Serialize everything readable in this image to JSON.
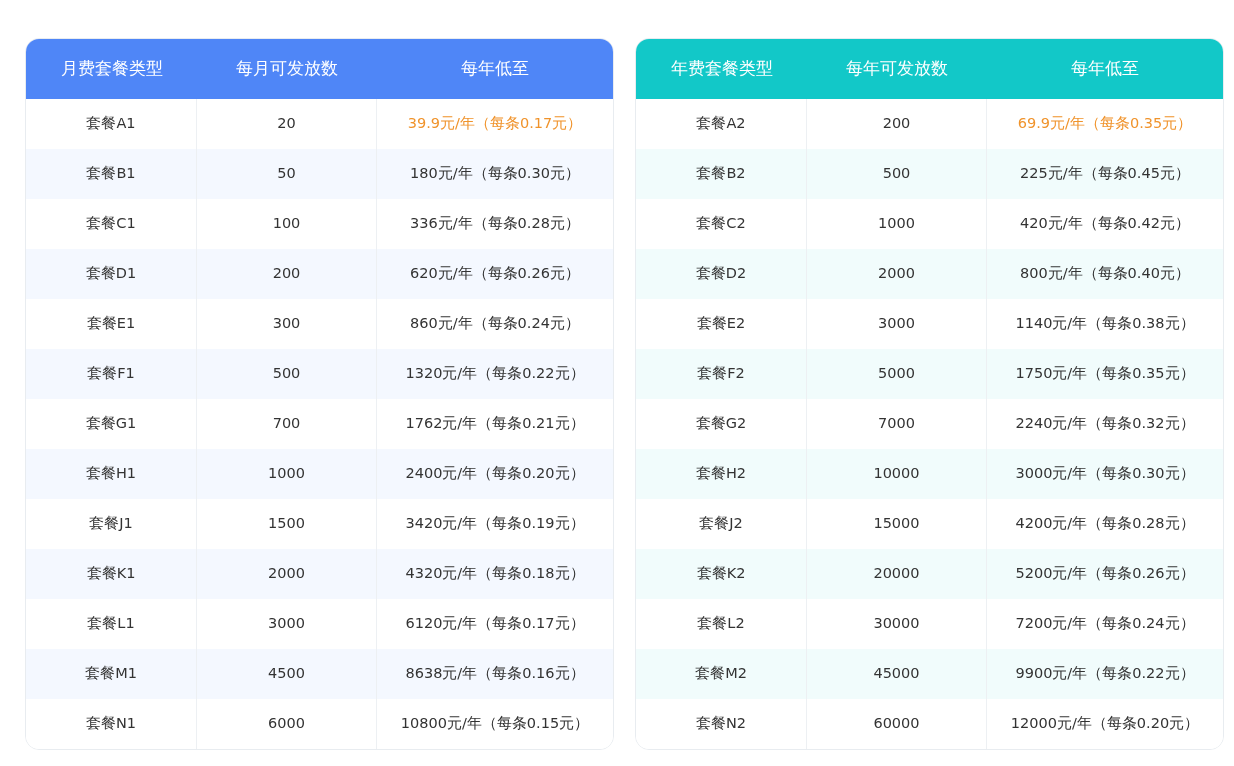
{
  "tables": [
    {
      "color": "#4f86f7",
      "columns": [
        "月费套餐类型",
        "每月可发放数",
        "每年低至"
      ],
      "rows": [
        {
          "cells": [
            "套餐A1",
            "20",
            "39.9元/年（每条0.17元）"
          ],
          "highlighted": true
        },
        {
          "cells": [
            "套餐B1",
            "50",
            "180元/年（每条0.30元）"
          ],
          "highlighted": false
        },
        {
          "cells": [
            "套餐C1",
            "100",
            "336元/年（每条0.28元）"
          ],
          "highlighted": false
        },
        {
          "cells": [
            "套餐D1",
            "200",
            "620元/年（每条0.26元）"
          ],
          "highlighted": false
        },
        {
          "cells": [
            "套餐E1",
            "300",
            "860元/年（每条0.24元）"
          ],
          "highlighted": false
        },
        {
          "cells": [
            "套餐F1",
            "500",
            "1320元/年（每条0.22元）"
          ],
          "highlighted": false
        },
        {
          "cells": [
            "套餐G1",
            "700",
            "1762元/年（每条0.21元）"
          ],
          "highlighted": false
        },
        {
          "cells": [
            "套餐H1",
            "1000",
            "2400元/年（每条0.20元）"
          ],
          "highlighted": false
        },
        {
          "cells": [
            "套餐J1",
            "1500",
            "3420元/年（每条0.19元）"
          ],
          "highlighted": false
        },
        {
          "cells": [
            "套餐K1",
            "2000",
            "4320元/年（每条0.18元）"
          ],
          "highlighted": false
        },
        {
          "cells": [
            "套餐L1",
            "3000",
            "6120元/年（每条0.17元）"
          ],
          "highlighted": false
        },
        {
          "cells": [
            "套餐M1",
            "4500",
            "8638元/年（每条0.16元）"
          ],
          "highlighted": false
        },
        {
          "cells": [
            "套餐N1",
            "6000",
            "10800元/年（每条0.15元）"
          ],
          "highlighted": false
        }
      ]
    },
    {
      "color": "#12c8c8",
      "columns": [
        "年费套餐类型",
        "每年可发放数",
        "每年低至"
      ],
      "rows": [
        {
          "cells": [
            "套餐A2",
            "200",
            "69.9元/年（每条0.35元）"
          ],
          "highlighted": true
        },
        {
          "cells": [
            "套餐B2",
            "500",
            "225元/年（每条0.45元）"
          ],
          "highlighted": false
        },
        {
          "cells": [
            "套餐C2",
            "1000",
            "420元/年（每条0.42元）"
          ],
          "highlighted": false
        },
        {
          "cells": [
            "套餐D2",
            "2000",
            "800元/年（每条0.40元）"
          ],
          "highlighted": false
        },
        {
          "cells": [
            "套餐E2",
            "3000",
            "1140元/年（每条0.38元）"
          ],
          "highlighted": false
        },
        {
          "cells": [
            "套餐F2",
            "5000",
            "1750元/年（每条0.35元）"
          ],
          "highlighted": false
        },
        {
          "cells": [
            "套餐G2",
            "7000",
            "2240元/年（每条0.32元）"
          ],
          "highlighted": false
        },
        {
          "cells": [
            "套餐H2",
            "10000",
            "3000元/年（每条0.30元）"
          ],
          "highlighted": false
        },
        {
          "cells": [
            "套餐J2",
            "15000",
            "4200元/年（每条0.28元）"
          ],
          "highlighted": false
        },
        {
          "cells": [
            "套餐K2",
            "20000",
            "5200元/年（每条0.26元）"
          ],
          "highlighted": false
        },
        {
          "cells": [
            "套餐L2",
            "30000",
            "7200元/年（每条0.24元）"
          ],
          "highlighted": false
        },
        {
          "cells": [
            "套餐M2",
            "45000",
            "9900元/年（每条0.22元）"
          ],
          "highlighted": false
        },
        {
          "cells": [
            "套餐N2",
            "60000",
            "12000元/年（每条0.20元）"
          ],
          "highlighted": false
        }
      ]
    }
  ]
}
